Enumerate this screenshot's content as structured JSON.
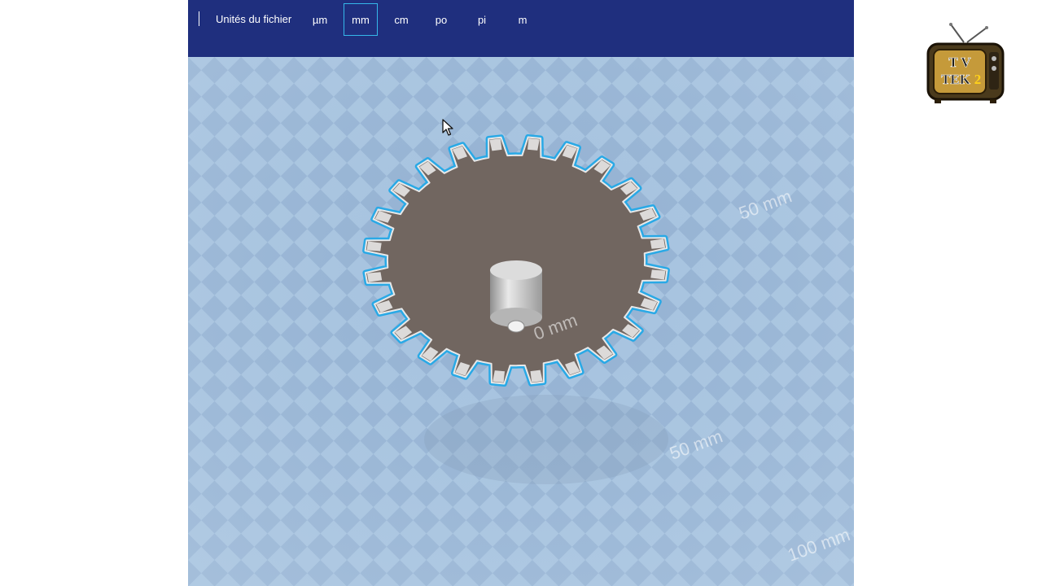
{
  "toolbar": {
    "units_label": "Unités du fichier",
    "units": [
      {
        "label": "µm",
        "selected": false
      },
      {
        "label": "mm",
        "selected": true
      },
      {
        "label": "cm",
        "selected": false
      },
      {
        "label": "po",
        "selected": false
      },
      {
        "label": "pi",
        "selected": false
      },
      {
        "label": "m",
        "selected": false
      }
    ]
  },
  "viewport": {
    "grid_labels": [
      "0 mm",
      "50 mm",
      "50 mm",
      "100 mm"
    ],
    "model": {
      "icon": "gear-model",
      "selection_color": "#29a9e6",
      "body_color": "#716660"
    }
  },
  "cursor": {
    "icon": "mouse-pointer-icon"
  },
  "logo": {
    "line1": "T V",
    "line2": "TEK",
    "badge": "2"
  },
  "colors": {
    "toolbar": "#1f2f7e",
    "grid_light": "#a3c0dd",
    "grid_dark": "#95b3d3",
    "accent": "#35b8ea"
  }
}
